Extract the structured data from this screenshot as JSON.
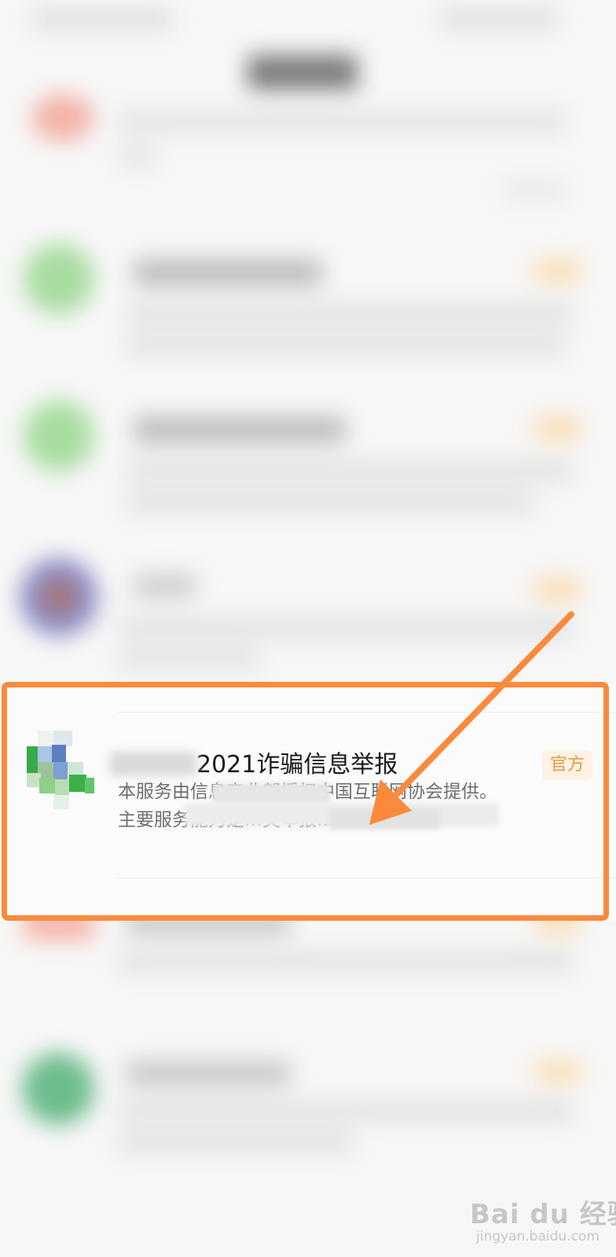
{
  "service": {
    "title": "2021诈骗信息举报",
    "badge": "官方",
    "desc_line1": "本服务由信息产业部授权中国互联网协会提供。",
    "desc_line2": "主要服务能力是…类举报…"
  },
  "watermark": {
    "brand": "Bai du 经验",
    "url": "jingyan.baidu.com"
  },
  "colors": {
    "highlight": "#fb8a3c",
    "badge_text": "#e89a3c",
    "badge_bg": "#fdf2e4"
  },
  "icons": {
    "app_icon": "green-blue-pixelated-app-icon",
    "arrow": "orange-arrow-pointer"
  }
}
